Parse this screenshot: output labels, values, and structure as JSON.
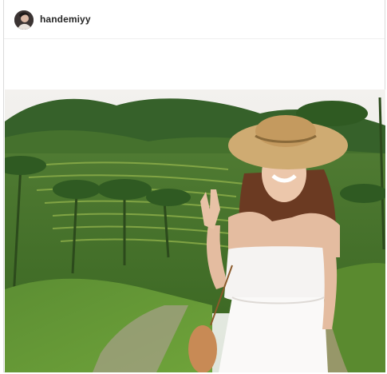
{
  "post": {
    "username": "handemiyy",
    "avatar_icon": "profile-avatar",
    "photo_subject": "woman-in-straw-hat-at-rice-terraces"
  },
  "colors": {
    "username_text": "#262626",
    "border": "#dbdbdb"
  }
}
